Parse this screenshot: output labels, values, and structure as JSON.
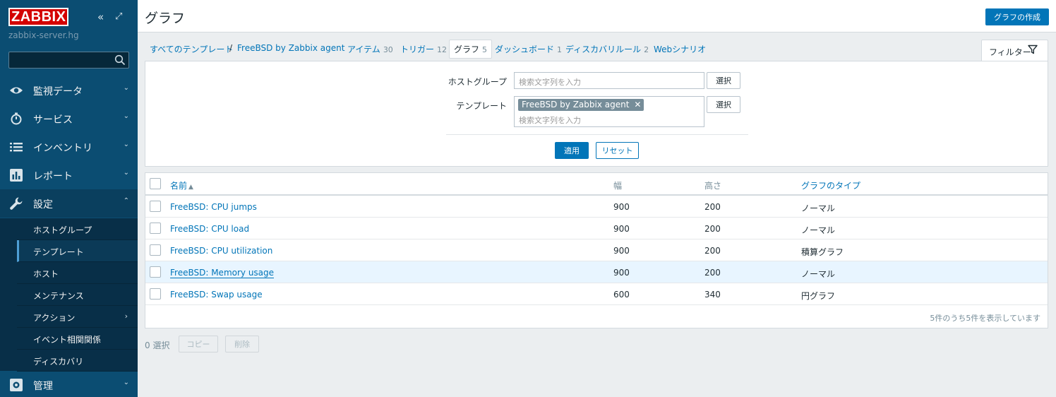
{
  "sidebar": {
    "logo": "ZABBIX",
    "server_name": "zabbix-server.hg",
    "collapse_glyph": "«",
    "kiosk_glyph": "⤢",
    "search_placeholder": "",
    "menu": [
      {
        "label": "監視データ",
        "icon": "eye-icon",
        "arrow": "⌄"
      },
      {
        "label": "サービス",
        "icon": "stopwatch-icon",
        "arrow": "⌄"
      },
      {
        "label": "インベントリ",
        "icon": "list-icon",
        "arrow": "⌄"
      },
      {
        "label": "レポート",
        "icon": "bar-chart-icon",
        "arrow": "⌄"
      },
      {
        "label": "設定",
        "icon": "wrench-icon",
        "arrow": "⌃"
      },
      {
        "label": "管理",
        "icon": "admin-gear-icon",
        "arrow": "⌄"
      }
    ],
    "submenu": [
      {
        "label": "ホストグループ"
      },
      {
        "label": "テンプレート"
      },
      {
        "label": "ホスト"
      },
      {
        "label": "メンテナンス"
      },
      {
        "label": "アクション",
        "arrow": "›"
      },
      {
        "label": "イベント相関関係"
      },
      {
        "label": "ディスカバリ"
      }
    ]
  },
  "header": {
    "title": "グラフ",
    "create_button": "グラフの作成"
  },
  "breadcrumbs": {
    "all_templates": "すべてのテンプレート",
    "separator": "/",
    "template": "FreeBSD by Zabbix agent",
    "tabs": [
      {
        "label": "アイテム",
        "count": "30"
      },
      {
        "label": "トリガー",
        "count": "12"
      },
      {
        "label": "グラフ",
        "count": "5"
      },
      {
        "label": "ダッシュボード",
        "count": "1"
      },
      {
        "label": "ディスカバリルール",
        "count": "2"
      },
      {
        "label": "Webシナリオ",
        "count": ""
      }
    ]
  },
  "filter": {
    "tab_label": "フィルター",
    "host_group_label": "ホストグループ",
    "host_group_placeholder": "検索文字列を入力",
    "template_label": "テンプレート",
    "template_tag": "FreeBSD by Zabbix agent",
    "template_tag_remove": "✕",
    "template_placeholder": "検索文字列を入力",
    "select_button": "選択",
    "apply_button": "適用",
    "reset_button": "リセット"
  },
  "table": {
    "columns": {
      "name": "名前",
      "sort_glyph": "▲",
      "width": "幅",
      "height": "高さ",
      "graph_type": "グラフのタイプ"
    },
    "rows": [
      {
        "name": "FreeBSD: CPU jumps",
        "width": "900",
        "height": "200",
        "type": "ノーマル"
      },
      {
        "name": "FreeBSD: CPU load",
        "width": "900",
        "height": "200",
        "type": "ノーマル"
      },
      {
        "name": "FreeBSD: CPU utilization",
        "width": "900",
        "height": "200",
        "type": "積算グラフ"
      },
      {
        "name": "FreeBSD: Memory usage",
        "width": "900",
        "height": "200",
        "type": "ノーマル"
      },
      {
        "name": "FreeBSD: Swap usage",
        "width": "600",
        "height": "340",
        "type": "円グラフ"
      }
    ],
    "footer": "5件のうち5件を表示しています"
  },
  "bulk": {
    "selected": "0 選択",
    "copy_button": "コピー",
    "delete_button": "削除"
  },
  "colors": {
    "sidebar": "#0b4d72",
    "accent": "#0275b8",
    "logo": "#d40000"
  }
}
